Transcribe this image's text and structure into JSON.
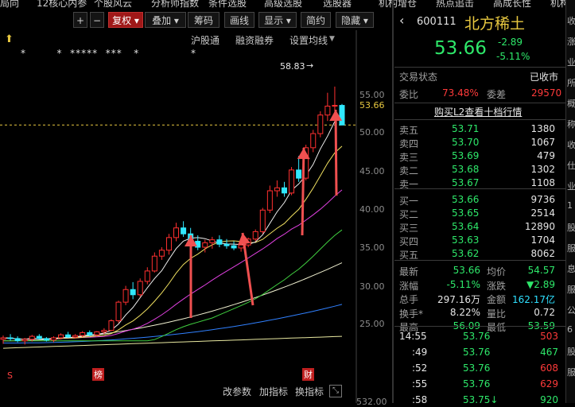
{
  "top_menu": [
    "局向",
    "12核心内参",
    "个股风云",
    "分析师指数",
    "条件选股",
    "高级选股",
    "选股器",
    "机构增仓",
    "热点追击",
    "高成长性",
    "机构调"
  ],
  "toolbar": {
    "buttons": [
      "+",
      "−",
      "复权",
      "叠加",
      "筹码",
      "画线",
      "显示",
      "简约",
      "隐藏"
    ],
    "active": "复权",
    "dropdown_flags": [
      false,
      false,
      true,
      true,
      false,
      false,
      true,
      false,
      true
    ]
  },
  "chart_links": [
    "沪股通",
    "融资融券",
    "设置均线"
  ],
  "chart_header_icon": "chart-marker-icon",
  "asterisks": "*        *  *****  ***   *",
  "y_axis": {
    "ticks": [
      55.0,
      50.0,
      45.0,
      40.0,
      35.0,
      30.0,
      25.0
    ],
    "labels": [
      "55.00",
      "50.00",
      "45.00",
      "40.00",
      "35.00",
      "30.00",
      "25.00"
    ],
    "current_price": "53.66",
    "high_mark": "58.83"
  },
  "y_bottom_label": "532.00",
  "bottom_tags": [
    "S",
    "榜",
    "财"
  ],
  "bottom_controls": [
    "改参数",
    "加指标",
    "换指标"
  ],
  "chart_data": {
    "type": "candlestick",
    "ylim": [
      22,
      60
    ],
    "candles": [
      [
        24.8,
        25.3,
        24.2,
        25.0
      ],
      [
        25.0,
        25.5,
        24.6,
        24.9
      ],
      [
        24.9,
        25.2,
        24.4,
        24.6
      ],
      [
        24.6,
        25.0,
        24.1,
        24.8
      ],
      [
        24.8,
        25.4,
        24.5,
        25.2
      ],
      [
        25.2,
        25.5,
        24.8,
        24.9
      ],
      [
        24.9,
        25.1,
        24.5,
        24.7
      ],
      [
        24.7,
        25.2,
        24.4,
        25.0
      ],
      [
        25.0,
        25.6,
        24.8,
        25.4
      ],
      [
        25.4,
        25.8,
        25.0,
        25.1
      ],
      [
        25.1,
        25.5,
        24.9,
        25.3
      ],
      [
        25.3,
        25.9,
        25.1,
        25.7
      ],
      [
        25.7,
        26.0,
        25.2,
        25.4
      ],
      [
        25.4,
        25.9,
        25.2,
        25.8
      ],
      [
        25.8,
        26.3,
        25.5,
        26.0
      ],
      [
        26.0,
        27.5,
        25.9,
        27.3
      ],
      [
        27.3,
        30.0,
        27.0,
        29.8
      ],
      [
        29.8,
        32.0,
        29.4,
        31.5
      ],
      [
        31.5,
        32.5,
        30.2,
        30.8
      ],
      [
        30.8,
        33.0,
        30.5,
        32.6
      ],
      [
        32.6,
        34.5,
        32.2,
        34.0
      ],
      [
        34.0,
        36.5,
        33.8,
        36.0
      ],
      [
        36.0,
        37.2,
        35.5,
        36.8
      ],
      [
        36.8,
        39.0,
        36.2,
        38.5
      ],
      [
        38.5,
        40.5,
        38.0,
        39.8
      ],
      [
        39.8,
        40.7,
        38.6,
        39.0
      ],
      [
        39.0,
        39.8,
        37.5,
        38.0
      ],
      [
        38.0,
        38.8,
        36.8,
        37.2
      ],
      [
        37.2,
        38.2,
        36.5,
        37.8
      ],
      [
        37.8,
        38.6,
        37.0,
        38.2
      ],
      [
        38.2,
        38.8,
        37.2,
        37.6
      ],
      [
        37.6,
        38.3,
        37.0,
        37.4
      ],
      [
        37.4,
        38.0,
        36.8,
        37.1
      ],
      [
        37.1,
        37.8,
        36.6,
        37.5
      ],
      [
        37.5,
        38.5,
        37.2,
        38.3
      ],
      [
        38.3,
        39.6,
        38.0,
        39.3
      ],
      [
        39.3,
        42.5,
        39.0,
        42.2
      ],
      [
        42.2,
        45.5,
        41.8,
        44.8
      ],
      [
        44.8,
        46.2,
        44.0,
        45.2
      ],
      [
        45.2,
        46.0,
        44.0,
        44.5
      ],
      [
        44.5,
        48.0,
        44.2,
        47.6
      ],
      [
        47.6,
        49.5,
        46.0,
        46.5
      ],
      [
        46.5,
        51.0,
        46.2,
        50.6
      ],
      [
        50.6,
        53.0,
        50.0,
        52.5
      ],
      [
        52.5,
        55.5,
        52.0,
        55.0
      ],
      [
        55.0,
        58.0,
        54.2,
        56.2
      ],
      [
        56.2,
        58.83,
        55.0,
        56.3
      ],
      [
        56.3,
        56.5,
        53.6,
        53.66
      ]
    ],
    "series": [
      {
        "name": "MA5",
        "color": "#f0f0f0"
      },
      {
        "name": "MA10",
        "color": "#f0e060"
      },
      {
        "name": "MA20",
        "color": "#e040e0"
      },
      {
        "name": "MA30",
        "color": "#40d040"
      },
      {
        "name": "MA60",
        "color": "#f0f0d0"
      },
      {
        "name": "MA120",
        "color": "#3080ff"
      },
      {
        "name": "MA250",
        "color": "#e8e8a0"
      }
    ]
  },
  "quote": {
    "code": "600111",
    "name": "北方稀土",
    "price": "53.66",
    "change": "-2.89",
    "change_pct": "-5.11%",
    "status_label": "交易状态",
    "status": "已收市",
    "weibi_label": "委比",
    "weibi": "73.48%",
    "weicha_label": "委差",
    "weicha": "29570",
    "l2_link": "购买L2查看十档行情",
    "asks": [
      {
        "label": "卖五",
        "price": "53.71",
        "vol": "1380"
      },
      {
        "label": "卖四",
        "price": "53.70",
        "vol": "1067"
      },
      {
        "label": "卖三",
        "price": "53.69",
        "vol": "479"
      },
      {
        "label": "卖二",
        "price": "53.68",
        "vol": "1302"
      },
      {
        "label": "卖一",
        "price": "53.67",
        "vol": "1108"
      }
    ],
    "bids": [
      {
        "label": "买一",
        "price": "53.66",
        "vol": "9736"
      },
      {
        "label": "买二",
        "price": "53.65",
        "vol": "2514"
      },
      {
        "label": "买三",
        "price": "53.64",
        "vol": "12890"
      },
      {
        "label": "买四",
        "price": "53.63",
        "vol": "1704"
      },
      {
        "label": "买五",
        "price": "53.62",
        "vol": "8062"
      }
    ],
    "stats": [
      {
        "l1": "最新",
        "v1": "53.66",
        "c1": "green",
        "l2": "均价",
        "v2": "54.57",
        "c2": "green"
      },
      {
        "l1": "涨幅",
        "v1": "-5.11%",
        "c1": "green",
        "l2": "涨跌",
        "v2": "▼2.89",
        "c2": "green"
      },
      {
        "l1": "总手",
        "v1": "297.16万",
        "c1": "white",
        "l2": "金额",
        "v2": "162.17亿",
        "c2": "cyan"
      },
      {
        "l1": "换手*",
        "v1": "8.22%",
        "c1": "white",
        "l2": "量比",
        "v2": "0.72",
        "c2": "white"
      },
      {
        "l1": "最高",
        "v1": "56.09",
        "c1": "green",
        "l2": "最低",
        "v2": "53.59",
        "c2": "green"
      }
    ],
    "ticks": [
      {
        "time": "14:55",
        "price": "53.76",
        "vol": "503",
        "vc": "red"
      },
      {
        "time": ":49",
        "price": "53.76",
        "vol": "467",
        "vc": "green"
      },
      {
        "time": ":52",
        "price": "53.76",
        "vol": "608",
        "vc": "red"
      },
      {
        "time": ":55",
        "price": "53.76",
        "vol": "629",
        "vc": "red"
      },
      {
        "time": ":58",
        "price": "53.75↓",
        "vol": "920",
        "vc": "green"
      }
    ]
  },
  "edge_text": [
    "收",
    "涨",
    "业",
    "所",
    "概",
    "称",
    "收",
    "仕",
    "业",
    "1",
    "股",
    "服",
    "息",
    "服",
    "公",
    "6",
    "股",
    "服"
  ]
}
